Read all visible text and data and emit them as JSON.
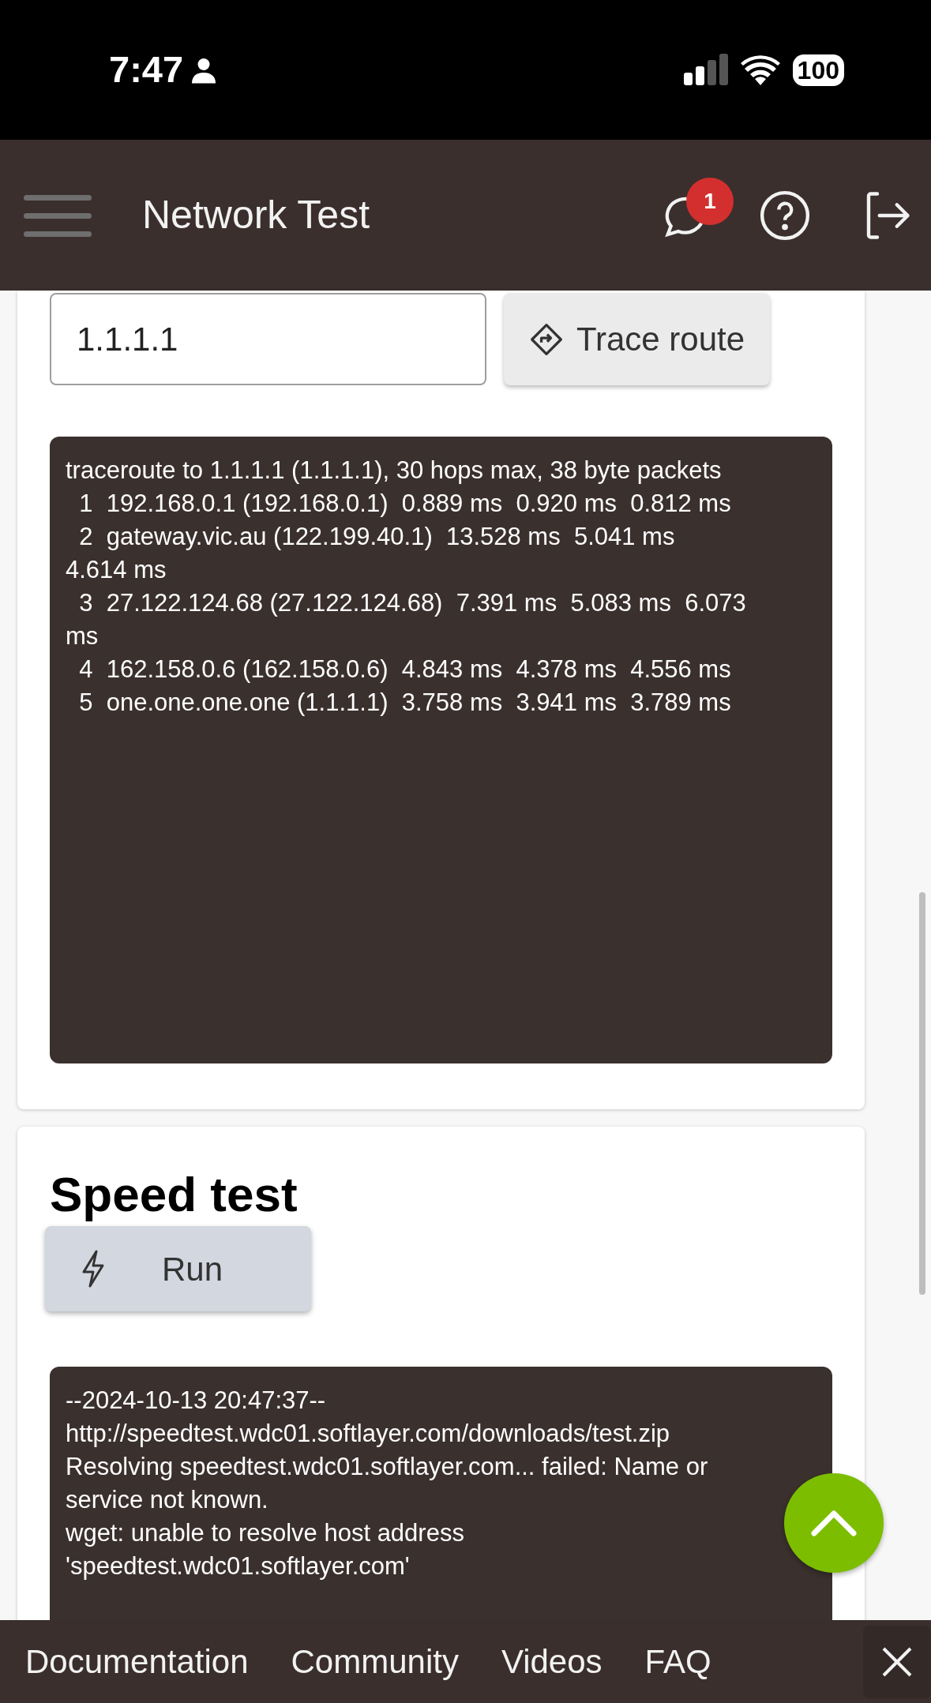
{
  "status_bar": {
    "time": "7:47",
    "battery": "100"
  },
  "app_bar": {
    "title": "Network Test",
    "notification_count": "1"
  },
  "traceroute": {
    "host_input": "1.1.1.1",
    "button": "Trace route",
    "output": [
      "traceroute to 1.1.1.1 (1.1.1.1), 30 hops max, 38 byte packets",
      "  1  192.168.0.1 (192.168.0.1)  0.889 ms  0.920 ms  0.812 ms",
      "  2  gateway.vic.au (122.199.40.1)  13.528 ms  5.041 ms",
      "4.614 ms",
      "  3  27.122.124.68 (27.122.124.68)  7.391 ms  5.083 ms  6.073",
      "ms",
      "  4  162.158.0.6 (162.158.0.6)  4.843 ms  4.378 ms  4.556 ms",
      "  5  one.one.one.one (1.1.1.1)  3.758 ms  3.941 ms  3.789 ms"
    ]
  },
  "speed_test": {
    "title": "Speed test",
    "button": "Run",
    "output": [
      "--2024-10-13 20:47:37--",
      "http://speedtest.wdc01.softlayer.com/downloads/test.zip",
      "Resolving speedtest.wdc01.softlayer.com... failed: Name or",
      "service not known.",
      "wget: unable to resolve host address",
      "'speedtest.wdc01.softlayer.com'"
    ]
  },
  "footer_links": [
    "Documentation",
    "Community",
    "Videos",
    "FAQ"
  ]
}
